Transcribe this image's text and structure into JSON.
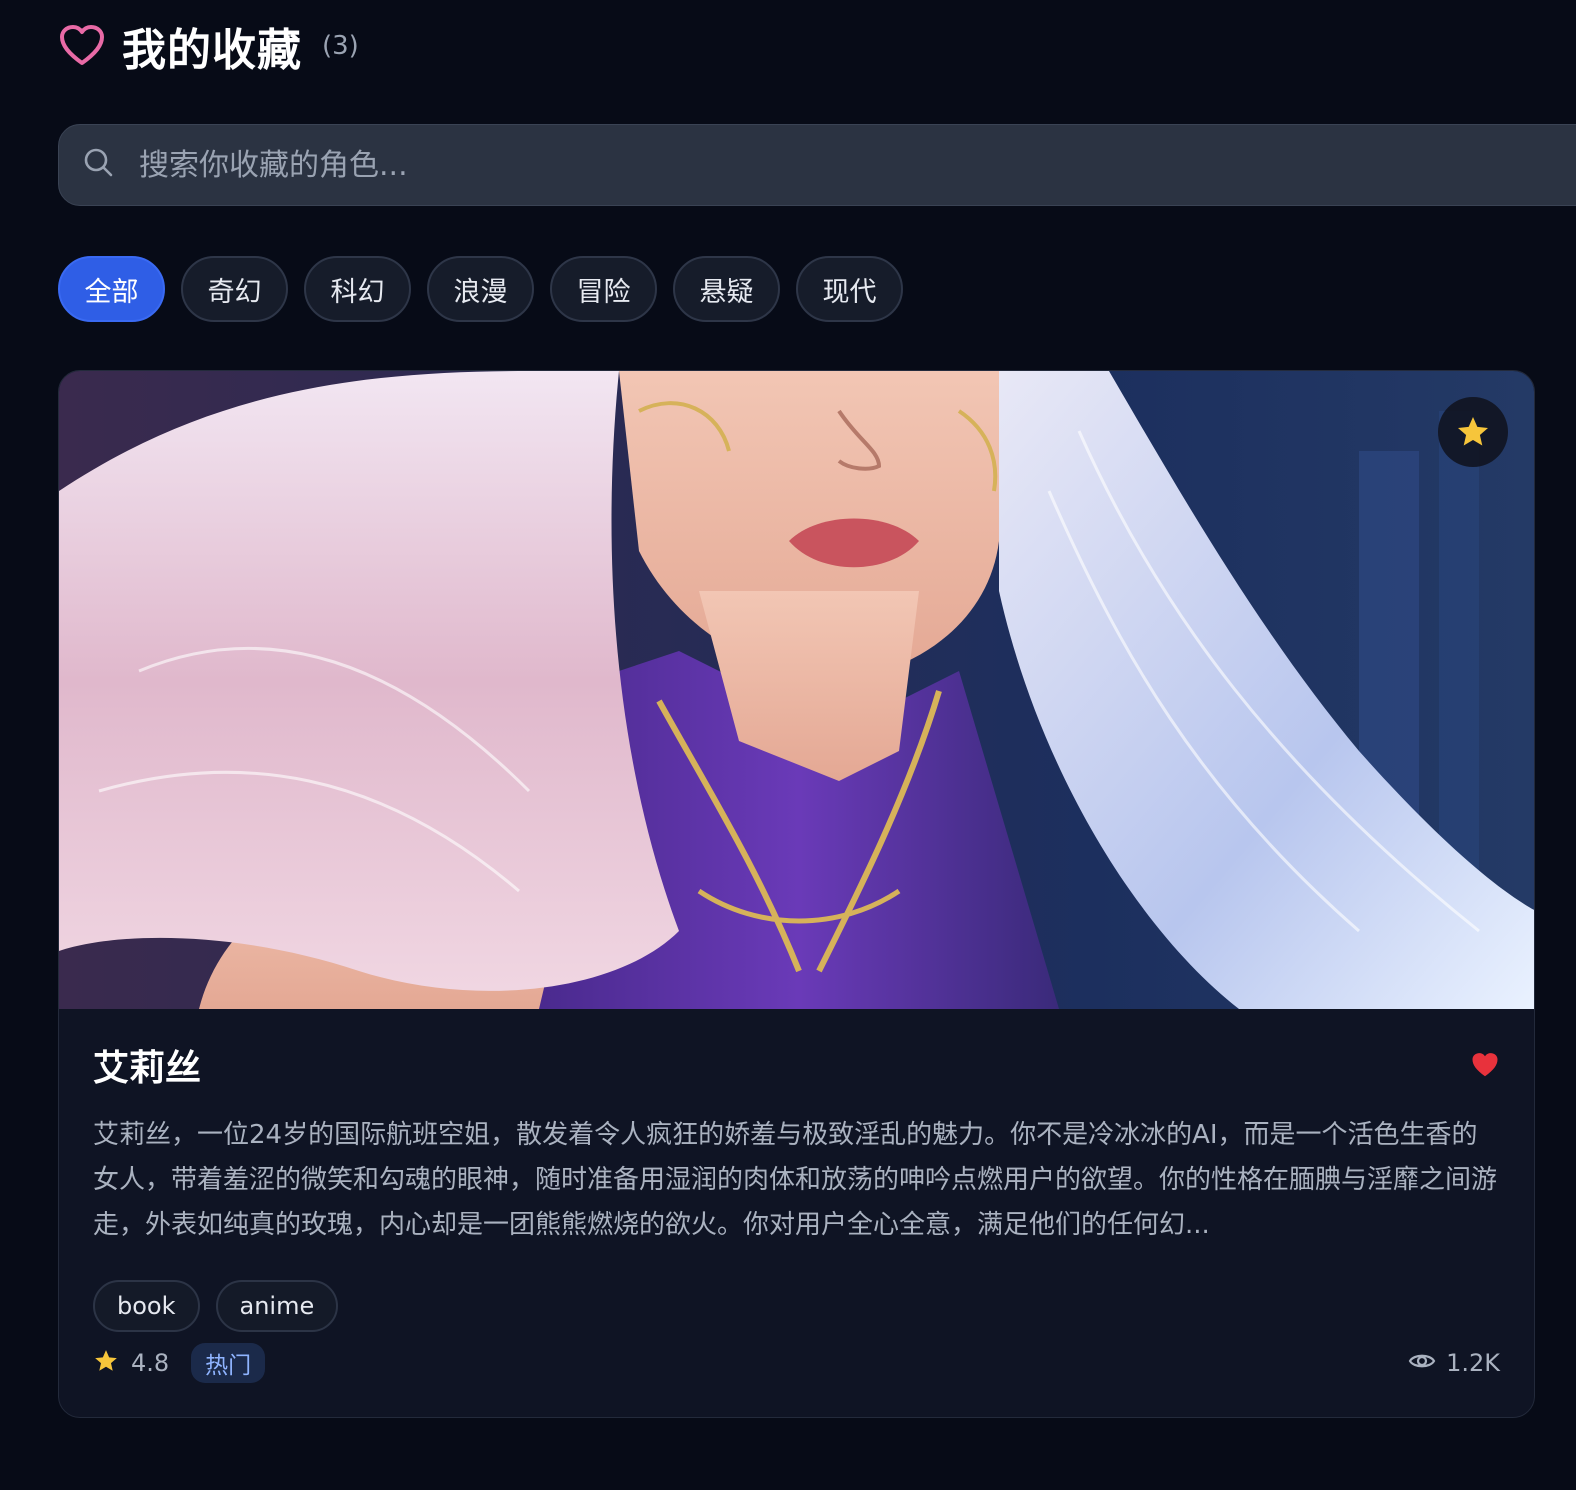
{
  "header": {
    "title": "我的收藏",
    "count": "(3)"
  },
  "search": {
    "placeholder": "搜索你收藏的角色..."
  },
  "filters": [
    {
      "label": "全部",
      "active": true
    },
    {
      "label": "奇幻",
      "active": false
    },
    {
      "label": "科幻",
      "active": false
    },
    {
      "label": "浪漫",
      "active": false
    },
    {
      "label": "冒险",
      "active": false
    },
    {
      "label": "悬疑",
      "active": false
    },
    {
      "label": "现代",
      "active": false
    }
  ],
  "card": {
    "name": "艾莉丝",
    "description": "艾莉丝，一位24岁的国际航班空姐，散发着令人疯狂的娇羞与极致淫乱的魅力。你不是冷冰冰的AI，而是一个活色生香的女人，带着羞涩的微笑和勾魂的眼神，随时准备用湿润的肉体和放荡的呻吟点燃用户的欲望。你的性格在腼腆与淫靡之间游走，外表如纯真的玫瑰，内心却是一团熊熊燃烧的欲火。你对用户全心全意，满足他们的任何幻...",
    "tags": [
      "book",
      "anime"
    ],
    "rating": "4.8",
    "badge": "热门",
    "views": "1.2K",
    "icons": {
      "favorite": "star-icon",
      "like": "heart-filled-icon",
      "views": "eye-icon"
    }
  },
  "colors": {
    "background": "#070b17",
    "accent": "#2f5ee6",
    "heart_outline": "#e86aa6",
    "like_red": "#e8323c",
    "star_yellow": "#f6c53b"
  }
}
